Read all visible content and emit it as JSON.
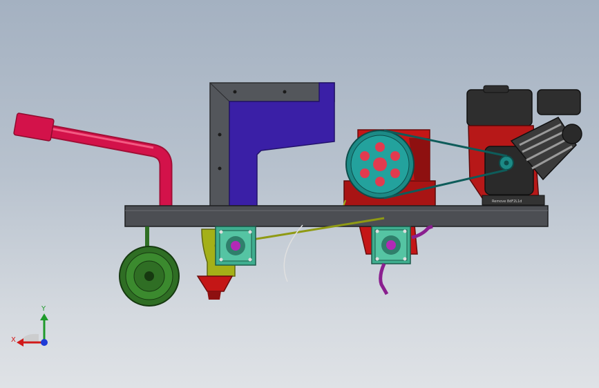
{
  "viewport": {
    "background_top": "#a4b1c1",
    "background_bottom": "#dfe2e6"
  },
  "engine": {
    "nameplate": "Remove 8dF2L1d"
  },
  "triad": {
    "x_label": "X",
    "y_label": "Y",
    "x_color": "#d11a1a",
    "y_color": "#1e9a2a",
    "z_color": "#1f3bd6"
  },
  "parts": {
    "frame_color": "#4c4e53",
    "hopper_color": "#3a1fa6",
    "handle_color": "#d3124a",
    "wheel_color": "#2f6e24",
    "pulley_color": "#1c8a86",
    "bearing_color": "#3fae8f",
    "engine_color": "#2a2a2a",
    "pump_color": "#c41616",
    "outlet_color": "#a4b018",
    "hose_color": "#8a1f8f"
  }
}
